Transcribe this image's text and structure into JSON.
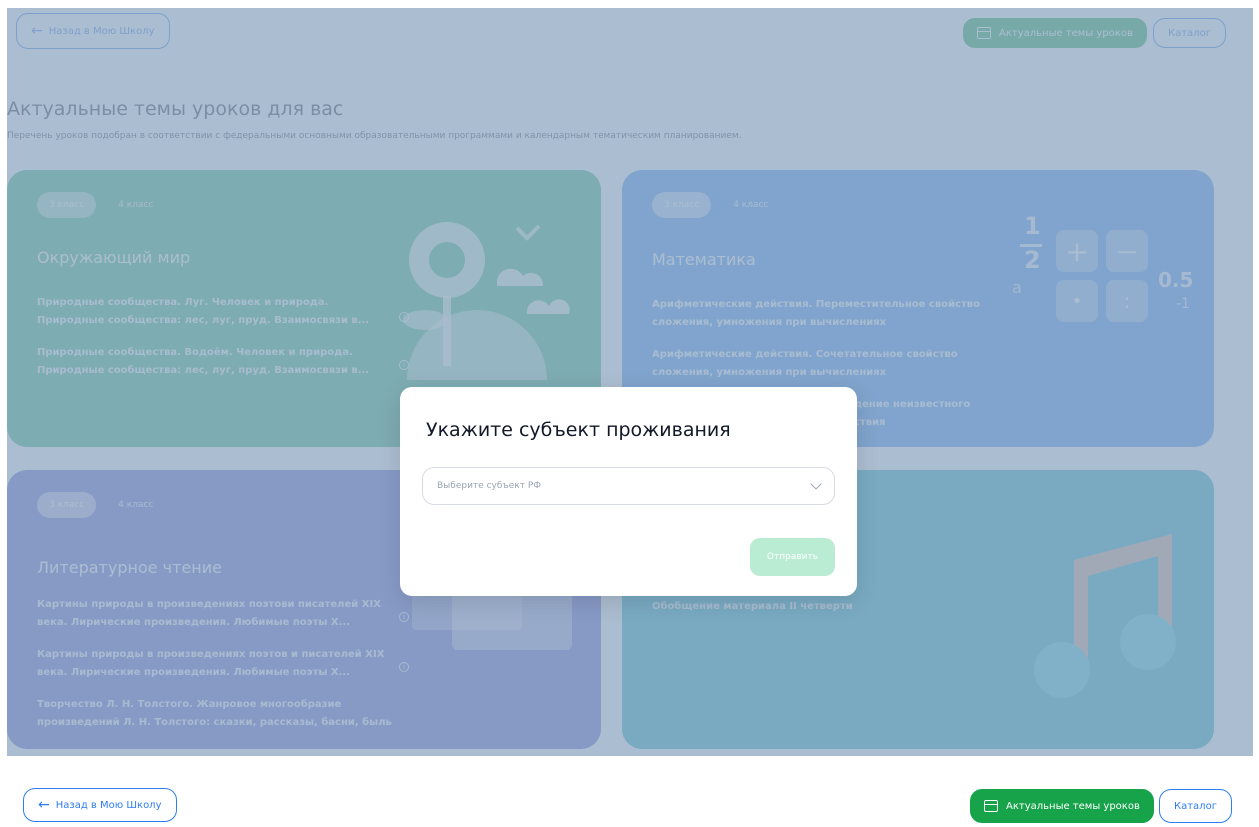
{
  "header": {
    "back_label": "Назад в Мою Школу",
    "topics_label": "Актуальные темы уроков",
    "catalog_label": "Каталог"
  },
  "page": {
    "title": "Актуальные темы уроков для вас",
    "subtitle": "Перечень уроков подобран в соответствии с федеральными основными образовательными программами и календарным тематическим планированием."
  },
  "cards": {
    "env": {
      "chip_active": "3 класс",
      "chip_other": "4 класс",
      "title": "Окружающий мир",
      "topics": [
        "Природные сообщества. Луг. Человек и природа. Природные сообщества: лес, луг, пруд. Взаимосвязи в...",
        "Природные сообщества. Водоём. Человек и природа. Природные сообщества: лес, луг, пруд. Взаимосвязи в..."
      ]
    },
    "math": {
      "chip_active": "3 класс",
      "chip_other": "4 класс",
      "title": "Математика",
      "topics": [
        "Арифметические действия. Переместительное свойство сложения, умножения при вычислениях",
        "Арифметические действия. Сочетательное свойство сложения, умножения при вычислениях",
        "дение неизвестного",
        "ствия"
      ],
      "illus": {
        "fraction_top": "1",
        "fraction_bottom": "2",
        "letter": "a",
        "plus": "+",
        "minus": "—",
        "dot": "•",
        "colon": ":",
        "num": "0.5",
        "neg": "-1"
      }
    },
    "lit": {
      "chip_active": "3 класс",
      "chip_other": "4 класс",
      "title": "Литературное чтение",
      "topics": [
        "Картины природы в произведениях поэтови писателей XIX века. Лирические произведения. Любимые поэты Х...",
        "Картины природы в произведениях поэтов и писателей XIX века. Лирические произведения. Любимые поэты Х...",
        "Творчество Л. Н. Толстого. Жанровое многообразие произведений Л. Н. Толстого: сказки, рассказы, басни, быль"
      ]
    },
    "music": {
      "topics": [
        "Обобщение материала II четверти"
      ]
    }
  },
  "modal": {
    "title": "Укажите субъект проживания",
    "select_placeholder": "Выберите субъект РФ",
    "submit_label": "Отправить"
  },
  "bottom": {
    "back_label": "Назад в Мою Школу",
    "topics_label": "Актуальные темы уроков",
    "catalog_label": "Каталог"
  },
  "colors": {
    "brand_blue": "#2f7df0",
    "brand_green": "#16a34a",
    "env_card": "#2fb277",
    "math_card": "#3c8ff2",
    "lit_card": "#5b5fcf",
    "music_card": "#1ba9bf"
  }
}
